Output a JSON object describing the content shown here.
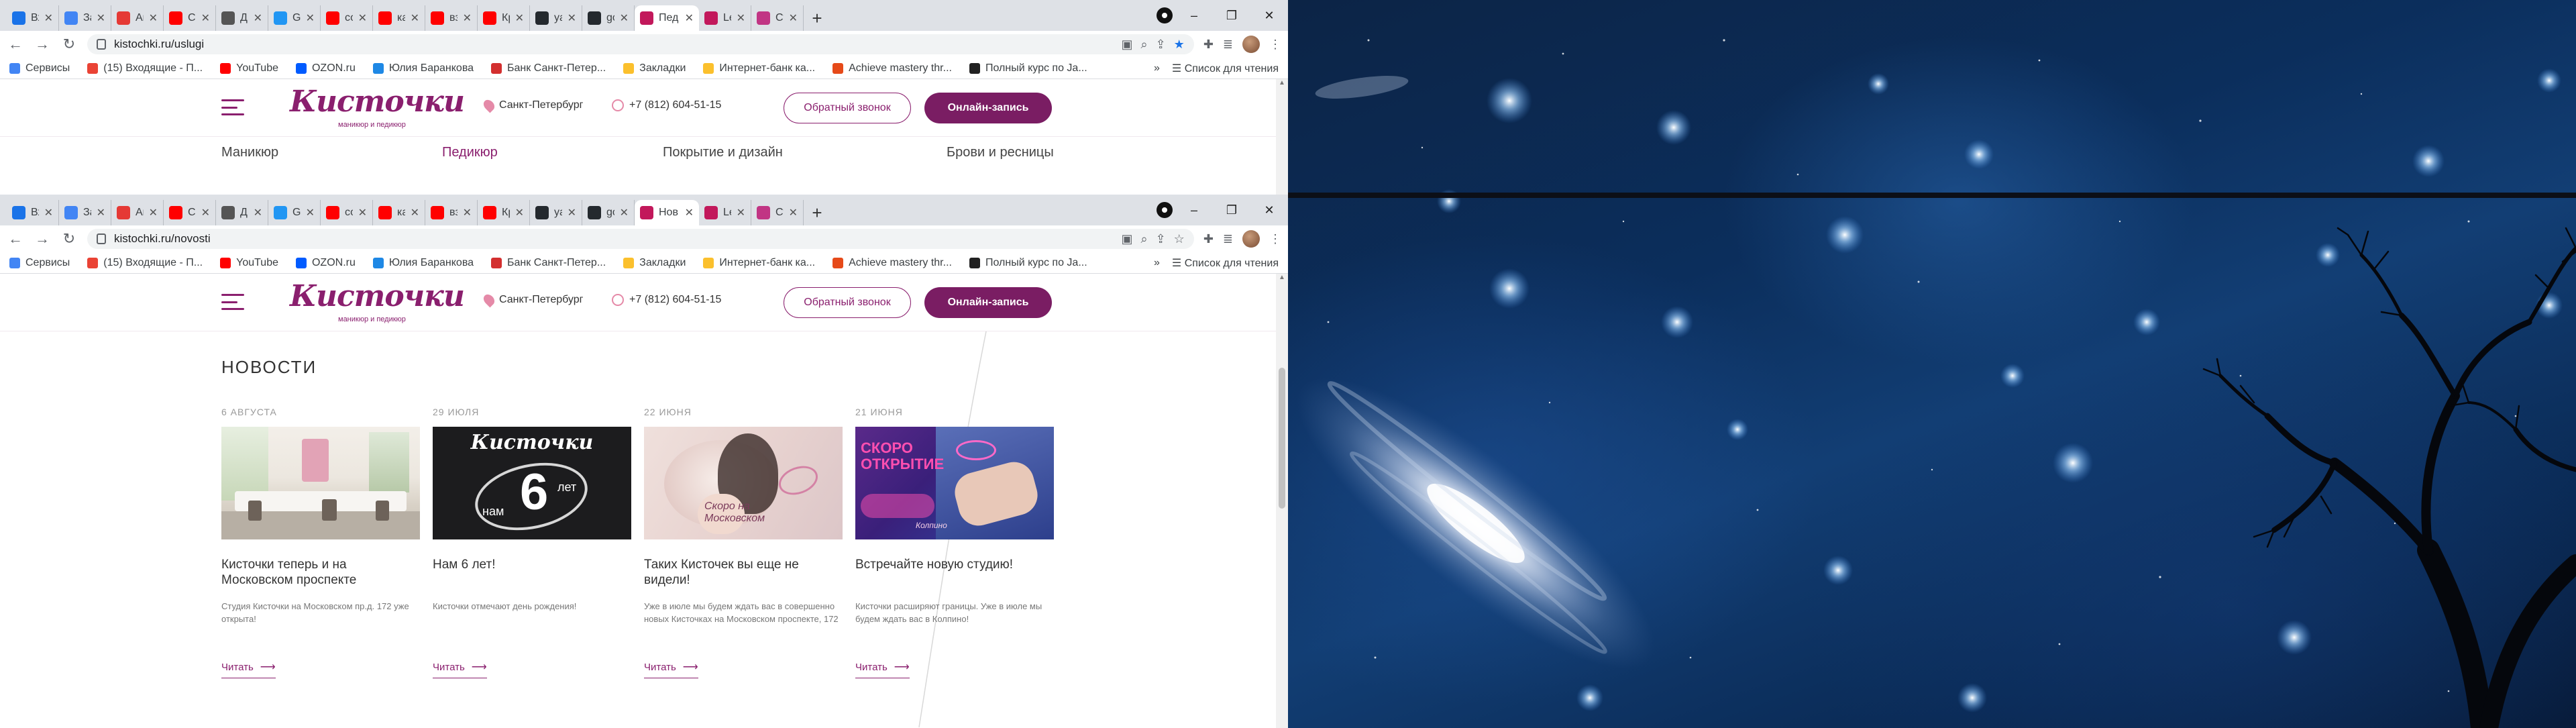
{
  "tabs": [
    {
      "title": "Вхо",
      "favicon_color": "#1a73e8",
      "favicon": "mail-icon"
    },
    {
      "title": "Зап",
      "favicon_color": "#4285f4",
      "favicon": "google-icon"
    },
    {
      "title": "Ави",
      "favicon_color": "#e53935",
      "favicon": "avito-icon"
    },
    {
      "title": "Chi",
      "favicon_color": "#ff0000",
      "favicon": "youtube-icon"
    },
    {
      "title": "Дне",
      "favicon_color": "#555555",
      "favicon": "diary-icon"
    },
    {
      "title": "GIS",
      "favicon_color": "#2196f3",
      "favicon": "gis-icon"
    },
    {
      "title": "соб",
      "favicon_color": "#ff0000",
      "favicon": "youtube-icon"
    },
    {
      "title": "как",
      "favicon_color": "#ff0000",
      "favicon": "youtube-icon"
    },
    {
      "title": "взл",
      "favicon_color": "#ff0000",
      "favicon": "youtube-icon"
    },
    {
      "title": "Кри",
      "favicon_color": "#ff0000",
      "favicon": "youtube-icon"
    },
    {
      "title": "yan",
      "favicon_color": "#24292e",
      "favicon": "github-icon"
    },
    {
      "title": "goi",
      "favicon_color": "#24292e",
      "favicon": "github-icon"
    },
    {
      "title": "Пед",
      "favicon_color": "#c2185b",
      "favicon": "kistochki-icon",
      "active": true
    },
    {
      "title": "Leo",
      "favicon_color": "#c2185b",
      "favicon": "kistochki-icon"
    },
    {
      "title": "Сту",
      "favicon_color": "#c13584",
      "favicon": "instagram-icon"
    }
  ],
  "tabs2": [
    {
      "title": "Вхо",
      "favicon_color": "#1a73e8",
      "favicon": "mail-icon"
    },
    {
      "title": "Зап",
      "favicon_color": "#4285f4",
      "favicon": "google-icon"
    },
    {
      "title": "Ави",
      "favicon_color": "#e53935",
      "favicon": "avito-icon"
    },
    {
      "title": "Chi",
      "favicon_color": "#ff0000",
      "favicon": "youtube-icon"
    },
    {
      "title": "Дне",
      "favicon_color": "#555555",
      "favicon": "diary-icon"
    },
    {
      "title": "GIS",
      "favicon_color": "#2196f3",
      "favicon": "gis-icon"
    },
    {
      "title": "соб",
      "favicon_color": "#ff0000",
      "favicon": "youtube-icon"
    },
    {
      "title": "как",
      "favicon_color": "#ff0000",
      "favicon": "youtube-icon"
    },
    {
      "title": "взл",
      "favicon_color": "#ff0000",
      "favicon": "youtube-icon"
    },
    {
      "title": "Кри",
      "favicon_color": "#ff0000",
      "favicon": "youtube-icon"
    },
    {
      "title": "yan",
      "favicon_color": "#24292e",
      "favicon": "github-icon"
    },
    {
      "title": "goi",
      "favicon_color": "#24292e",
      "favicon": "github-icon"
    },
    {
      "title": "Нов",
      "favicon_color": "#c2185b",
      "favicon": "kistochki-icon",
      "active": true
    },
    {
      "title": "Leo",
      "favicon_color": "#c2185b",
      "favicon": "kistochki-icon"
    },
    {
      "title": "Сту",
      "favicon_color": "#c13584",
      "favicon": "instagram-icon"
    }
  ],
  "window1": {
    "url": "kistochki.ru/uslugi",
    "bookmark_starred": true
  },
  "window2": {
    "url": "kistochki.ru/novosti",
    "bookmark_starred": false
  },
  "bookmarks": [
    {
      "label": "Сервисы",
      "color": "#4285f4"
    },
    {
      "label": "(15) Входящие - П...",
      "color": "#ea4335"
    },
    {
      "label": "YouTube",
      "color": "#ff0000"
    },
    {
      "label": "OZON.ru",
      "color": "#005bff"
    },
    {
      "label": "Юлия Баранкова",
      "color": "#1e88e5"
    },
    {
      "label": "Банк Санкт-Петер...",
      "color": "#d32f2f"
    },
    {
      "label": "Закладки",
      "color": "#fbc02d"
    },
    {
      "label": "Интернет-банк ка...",
      "color": "#fbc02d"
    },
    {
      "label": "Achieve mastery thr...",
      "color": "#e64a19"
    },
    {
      "label": "Полный курс по Ja...",
      "color": "#212121"
    }
  ],
  "bookmarks_more": "»",
  "reading_list": "Список для чтения",
  "site": {
    "logo_text": "Кисточки",
    "logo_sub": "маникюр и педикюр",
    "city": "Санкт-Петербург",
    "phone": "+7 (812) 604-51-15",
    "callback_btn": "Обратный звонок",
    "booking_btn": "Онлайн-запись",
    "brand_color": "#8a1f6e"
  },
  "services_nav": [
    {
      "label": "Маникюр",
      "active": false
    },
    {
      "label": "Педикюр",
      "active": true
    },
    {
      "label": "Покрытие и дизайн",
      "active": false
    },
    {
      "label": "Брови и ресницы",
      "active": false
    }
  ],
  "news": {
    "title": "НОВОСТИ",
    "read_more": "Читать",
    "items": [
      {
        "date": "6 АВГУСТА",
        "headline": "Кисточки теперь и на Московском проспекте",
        "desc": "Студия Кисточки на Московском пр.д. 172 уже открыта!"
      },
      {
        "date": "29 ИЮЛЯ",
        "headline": "Нам 6 лет!",
        "desc": "Кисточки отмечают день рождения!"
      },
      {
        "date": "22 ИЮНЯ",
        "headline": "Таких Кисточек вы еще не видели!",
        "desc": "Уже в июле мы будем ждать вас в совершенно новых Кисточках на Московском проспекте, 172"
      },
      {
        "date": "21 ИЮНЯ",
        "headline": "Встречайте новую студию!",
        "desc": "Кисточки расширяют границы. Уже в июле мы будем ждать вас в Колпино!"
      }
    ],
    "img_texts": {
      "card2_logo": "Кисточки",
      "card2_text1": "нам",
      "card2_number": "6",
      "card2_text2": "лет",
      "card3_text": "Скоро на Московском",
      "card4_text1": "СКОРО",
      "card4_text2": "ОТКРЫТИЕ",
      "card4_text3": "Колпино"
    }
  },
  "window_controls": {
    "minimize": "–",
    "maximize": "❐",
    "close": "✕"
  }
}
